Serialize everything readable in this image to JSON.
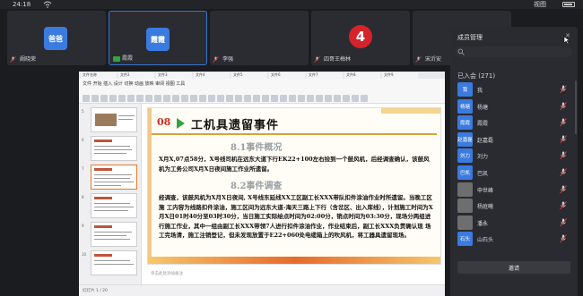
{
  "status_bar": {
    "time": "24:18",
    "view_label": "视图"
  },
  "tiles": [
    {
      "type": "avatar",
      "avatar_text": "爸爸",
      "avatar_color": "#3b7be0",
      "name": "阚晓荣"
    },
    {
      "type": "avatar",
      "avatar_text": "霞霞",
      "avatar_color": "#3b7be0",
      "name": "霞霞"
    },
    {
      "type": "blank",
      "name": "李强"
    },
    {
      "type": "logo",
      "logo_text": "4",
      "name": "四哥王梅林"
    },
    {
      "type": "blank",
      "name": "宋沂安"
    }
  ],
  "share": {
    "tabs": [
      "文件名称",
      "文件2",
      "文件3",
      "文件4",
      "文件5",
      "文件6",
      "文件7",
      "文件8",
      "文件9"
    ],
    "menu": "文件  开始  插入  设计  切换  动画  放映  审阅  视图  工具",
    "slide": {
      "number": "08",
      "title": "工机具遗留事件",
      "sec1": "8.1事件概况",
      "p1": "X月X,07点58分，X号线司机在远东大道下行EK22+100左右捡到一个鼓风机，后经调查确认，该鼓风机为工务公司X月X日夜间施工作业所遗留。",
      "sec2": "8.2事件调查",
      "p2": "经调查，该鼓风机为X月X日夜间, X号线东延线XX工区副工长XXX带队扣件涂油作业时所遗留。当晚工区施 工内容为线路扣件涂油，施工区间为远东大道-海天三路上下行（含岔区、出入库线），计划施工时间为X月X日01时40分至03时30分，当日施工实际绘点时间为02:00分，销点时间为03:30分，现场分两组进行施工作业，其中一组由副工长XXX带领7人进行扣件涂油作业，作业结束后，副工长XXX负责确认现 场工完场清，施工注销登记，但未发现放置于E22+060处电缆箱上的吹风机，将工器具遗留现场。"
    },
    "notes": "单击此处添加备注",
    "status": "幻灯片 1 / 20"
  },
  "panel": {
    "header": "成员管理",
    "group_label": "已入会 (271)",
    "members": [
      {
        "avatar": "我",
        "name": "我",
        "color": "#3b7be0"
      },
      {
        "avatar": "杨塘",
        "name": "杨塘",
        "color": "#3b7be0"
      },
      {
        "avatar": "霞霞",
        "name": "霞霞",
        "color": "#3b7be0"
      },
      {
        "avatar": "赵嘉磊",
        "name": "赵嘉磊",
        "color": "#3b7be0"
      },
      {
        "avatar": "刘力",
        "name": "刘力",
        "color": "#3b7be0"
      },
      {
        "avatar": "巴凯",
        "name": "巴凯",
        "color": "#3b7be0"
      },
      {
        "avatar": "",
        "name": "申世峰",
        "color": "#6e6e6e"
      },
      {
        "avatar": "",
        "name": "杨庭曦",
        "color": "#6e6e6e"
      },
      {
        "avatar": "",
        "name": "潘永",
        "color": "#6e6e6e"
      },
      {
        "avatar": "石头",
        "name": "山石头",
        "color": "#3b7be0"
      }
    ],
    "invite_label": "邀请"
  }
}
